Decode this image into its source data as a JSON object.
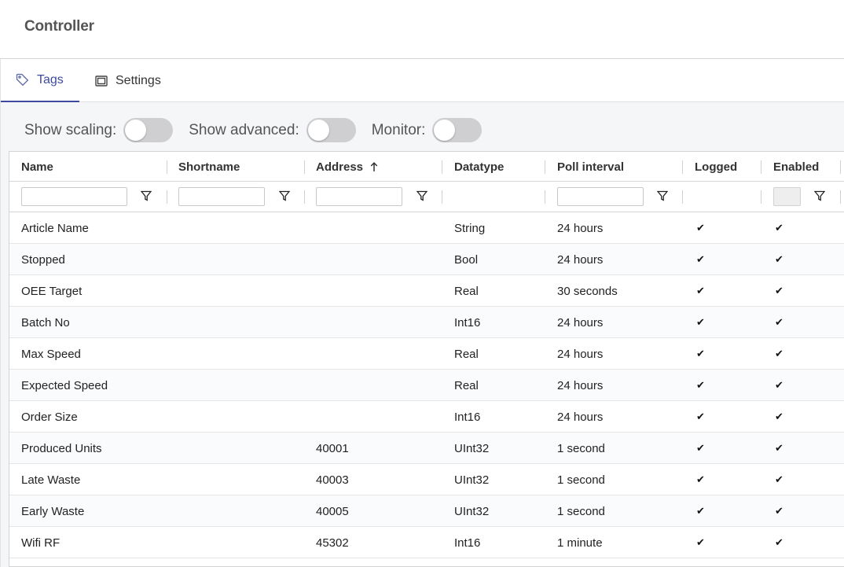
{
  "header": {
    "title": "Controller"
  },
  "tabs": [
    {
      "label": "Tags",
      "icon": "tag-icon",
      "active": true
    },
    {
      "label": "Settings",
      "icon": "window-icon",
      "active": false
    }
  ],
  "toggles": {
    "show_scaling": {
      "label": "Show scaling:",
      "on": false
    },
    "show_advanced": {
      "label": "Show advanced:",
      "on": false
    },
    "monitor": {
      "label": "Monitor:",
      "on": false
    }
  },
  "columns": {
    "name": "Name",
    "shortname": "Shortname",
    "address": "Address",
    "address_sort_icon": "arrow-up-icon",
    "datatype": "Datatype",
    "poll_interval": "Poll interval",
    "logged": "Logged",
    "enabled": "Enabled"
  },
  "filters": {
    "name": "",
    "shortname": "",
    "address": "",
    "poll_interval": ""
  },
  "check_glyph": "✔",
  "rows": [
    {
      "name": "Article Name",
      "shortname": "",
      "address": "",
      "datatype": "String",
      "poll_interval": "24 hours",
      "logged": true,
      "enabled": true
    },
    {
      "name": "Stopped",
      "shortname": "",
      "address": "",
      "datatype": "Bool",
      "poll_interval": "24 hours",
      "logged": true,
      "enabled": true
    },
    {
      "name": "OEE Target",
      "shortname": "",
      "address": "",
      "datatype": "Real",
      "poll_interval": "30 seconds",
      "logged": true,
      "enabled": true
    },
    {
      "name": "Batch No",
      "shortname": "",
      "address": "",
      "datatype": "Int16",
      "poll_interval": "24 hours",
      "logged": true,
      "enabled": true
    },
    {
      "name": "Max Speed",
      "shortname": "",
      "address": "",
      "datatype": "Real",
      "poll_interval": "24 hours",
      "logged": true,
      "enabled": true
    },
    {
      "name": "Expected Speed",
      "shortname": "",
      "address": "",
      "datatype": "Real",
      "poll_interval": "24 hours",
      "logged": true,
      "enabled": true
    },
    {
      "name": "Order Size",
      "shortname": "",
      "address": "",
      "datatype": "Int16",
      "poll_interval": "24 hours",
      "logged": true,
      "enabled": true
    },
    {
      "name": "Produced Units",
      "shortname": "",
      "address": "40001",
      "datatype": "UInt32",
      "poll_interval": "1 second",
      "logged": true,
      "enabled": true
    },
    {
      "name": "Late Waste",
      "shortname": "",
      "address": "40003",
      "datatype": "UInt32",
      "poll_interval": "1 second",
      "logged": true,
      "enabled": true
    },
    {
      "name": "Early Waste",
      "shortname": "",
      "address": "40005",
      "datatype": "UInt32",
      "poll_interval": "1 second",
      "logged": true,
      "enabled": true
    },
    {
      "name": "Wifi RF",
      "shortname": "",
      "address": "45302",
      "datatype": "Int16",
      "poll_interval": "1 minute",
      "logged": true,
      "enabled": true
    }
  ]
}
